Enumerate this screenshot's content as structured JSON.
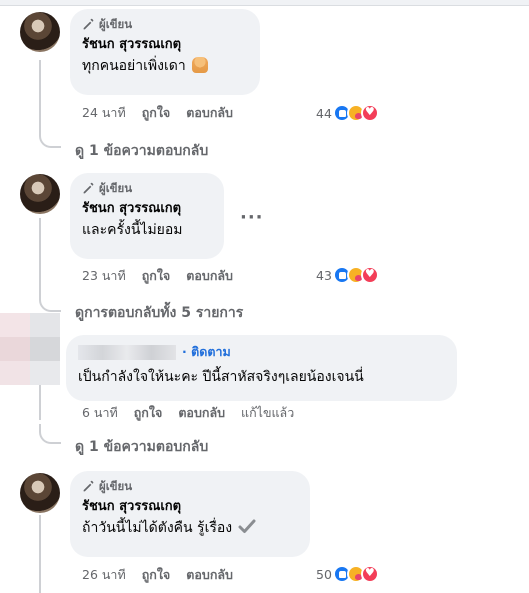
{
  "comments": [
    {
      "badge": "ผู้เขียน",
      "name": "รัชนก สุวรรณเกตุ",
      "text": "ทุกคนอย่าเพิ่งเดา",
      "emoji": "folded-hands-emoji",
      "time": "24 นาที",
      "like_label": "ถูกใจ",
      "reply_label": "ตอบกลับ",
      "reaction_count": "44",
      "view_replies": "ดู 1 ข้อความตอบกลับ"
    },
    {
      "badge": "ผู้เขียน",
      "name": "รัชนก สุวรรณเกตุ",
      "text": "และครั้งนี้ไม่ยอม",
      "more": "···",
      "time": "23 นาที",
      "like_label": "ถูกใจ",
      "reply_label": "ตอบกลับ",
      "reaction_count": "43",
      "view_replies": "ดูการตอบกลับทั้ง 5 รายการ"
    },
    {
      "follow_label": "· ติดตาม",
      "text": "เป็นกำลังใจให้นะคะ ปีนี้สาหัสจริงๆเลยน้องเจนนี่",
      "time": "6 นาที",
      "like_label": "ถูกใจ",
      "reply_label": "ตอบกลับ",
      "edited_label": "แก้ไขแล้ว",
      "view_replies": "ดู 1 ข้อความตอบกลับ"
    },
    {
      "badge": "ผู้เขียน",
      "name": "รัชนก สุวรรณเกตุ",
      "text": "ถ้าวันนี้ไม่ได้ตังคืน รู้เรื่อง",
      "emoji": "check-mark-emoji",
      "time": "26 นาที",
      "like_label": "ถูกใจ",
      "reply_label": "ตอบกลับ",
      "reaction_count": "50"
    }
  ],
  "reactions": [
    "like-icon",
    "care-icon",
    "love-icon"
  ],
  "colors": {
    "bubble": "#f0f2f5",
    "meta": "#65676b",
    "follow": "#216fdb",
    "like": "#1877f2",
    "love": "#f33e58"
  }
}
